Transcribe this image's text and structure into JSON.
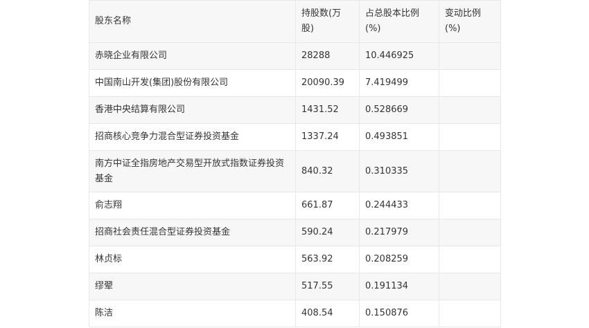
{
  "table": {
    "headers": [
      "股东名称",
      "持股数(万股)",
      "占总股本比例(%)",
      "变动比例(%)"
    ],
    "rows": [
      {
        "name": "赤晓企业有限公司",
        "shares": "28288",
        "ratio": "10.446925",
        "change": ""
      },
      {
        "name": "中国南山开发(集团)股份有限公司",
        "shares": "20090.39",
        "ratio": "7.419499",
        "change": ""
      },
      {
        "name": "香港中央结算有限公司",
        "shares": "1431.52",
        "ratio": "0.528669",
        "change": ""
      },
      {
        "name": "招商核心竞争力混合型证券投资基金",
        "shares": "1337.24",
        "ratio": "0.493851",
        "change": ""
      },
      {
        "name": "南方中证全指房地产交易型开放式指数证券投资基金",
        "shares": "840.32",
        "ratio": "0.310335",
        "change": ""
      },
      {
        "name": "俞志翔",
        "shares": "661.87",
        "ratio": "0.244433",
        "change": ""
      },
      {
        "name": "招商社会责任混合型证券投资基金",
        "shares": "590.24",
        "ratio": "0.217979",
        "change": ""
      },
      {
        "name": "林贞标",
        "shares": "563.92",
        "ratio": "0.208259",
        "change": ""
      },
      {
        "name": "缪翚",
        "shares": "517.55",
        "ratio": "0.191134",
        "change": ""
      },
      {
        "name": "陈洁",
        "shares": "408.54",
        "ratio": "0.150876",
        "change": ""
      }
    ]
  }
}
